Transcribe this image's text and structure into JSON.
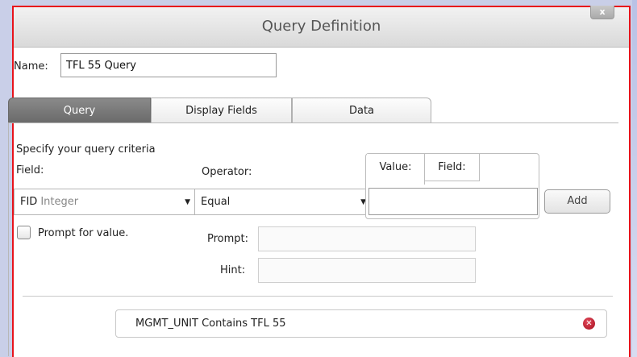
{
  "dialog": {
    "title": "Query Definition",
    "close_label": "x"
  },
  "name": {
    "label": "Name:",
    "value": "TFL 55 Query"
  },
  "tabs": [
    {
      "label": "Query",
      "active": true
    },
    {
      "label": "Display Fields",
      "active": false
    },
    {
      "label": "Data",
      "active": false
    }
  ],
  "query": {
    "instructions": "Specify your query criteria",
    "field_label": "Field:",
    "field_value": "FID",
    "field_type": "Integer",
    "operator_label": "Operator:",
    "operator_value": "Equal",
    "value_tab_label": "Value:",
    "field_tab_label": "Field:",
    "add_label": "Add",
    "prompt_checkbox_label": "Prompt for value.",
    "prompt_label": "Prompt:",
    "hint_label": "Hint:",
    "criteria": [
      {
        "text": "MGMT_UNIT Contains TFL 55"
      }
    ]
  },
  "icons": {
    "dropdown": "chevron-down-icon",
    "remove": "remove-circle-icon"
  }
}
